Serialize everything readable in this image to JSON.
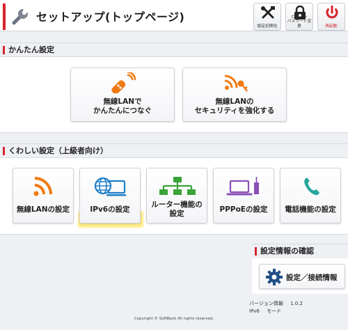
{
  "header": {
    "title": "セットアップ(トップページ)",
    "buttons": [
      {
        "label": "設定初期化",
        "icon": "tools-icon"
      },
      {
        "label": "ログイン\nパスワード変更",
        "icon": "lock-icon"
      },
      {
        "label": "再起動",
        "icon": "power-icon"
      }
    ]
  },
  "easy_setup": {
    "title": "かんたん設定",
    "cards": [
      {
        "label": "無線LANで\nかんたんにつなぐ",
        "icon": "wireless-remote-icon"
      },
      {
        "label": "無線LANの\nセキュリティを強化する",
        "icon": "wireless-key-icon"
      }
    ]
  },
  "advanced_setup": {
    "title": "くわしい設定（上級者向け）",
    "cards": [
      {
        "label": "無線LANの設定",
        "icon": "wifi-icon"
      },
      {
        "label": "IPv6の設定",
        "icon": "globe-monitor-icon"
      },
      {
        "label": "ルーター機能の\n設定",
        "icon": "network-tree-icon"
      },
      {
        "label": "PPPoEの設定",
        "icon": "laptop-router-icon"
      },
      {
        "label": "電話機能の設定",
        "icon": "phone-icon"
      }
    ]
  },
  "confirm": {
    "title": "設定情報の確認",
    "button_label": "設定／接続情報",
    "button_icon": "gear-icon"
  },
  "info": {
    "version_label": "バージョン情報",
    "version_value": "1.0.2",
    "ipv6_label": "IPv6",
    "ipv6_value": "モード"
  },
  "footer": {
    "copyright": "Copyright © SoftBank All rights reserved."
  },
  "colors": {
    "accent_red": "#d8232a",
    "orange": "#f07a12",
    "blue": "#1f7fc6",
    "green": "#3aa33a",
    "purple": "#8a4fb5",
    "teal": "#26a69a",
    "navy": "#1f4f84"
  }
}
